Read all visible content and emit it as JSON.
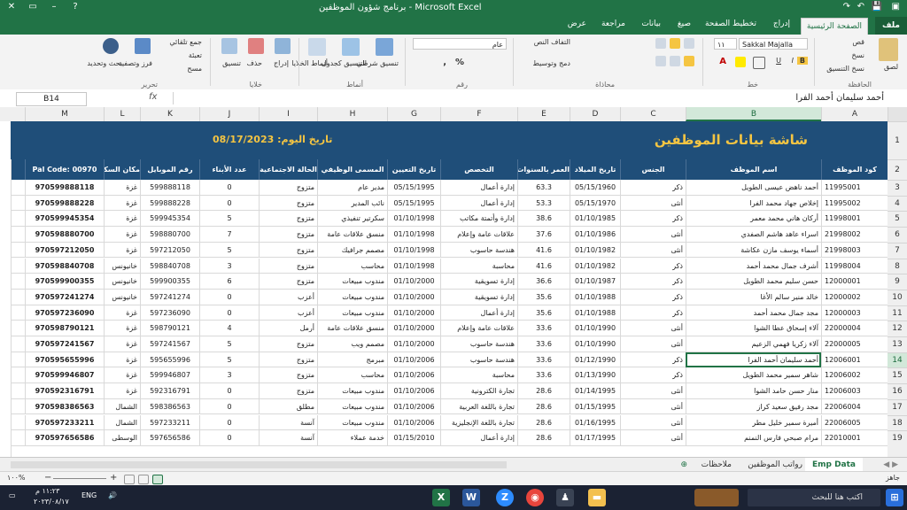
{
  "window": {
    "title": "برنامج شؤون الموظفين  -  Microsoft Excel",
    "min": "–",
    "max": "▭",
    "close": "✕",
    "help": "?"
  },
  "tabs": [
    "ملف",
    "الصفحة الرئيسية",
    "إدراج",
    "تخطيط الصفحة",
    "صيغ",
    "بيانات",
    "مراجعة",
    "عرض"
  ],
  "ribbon": {
    "clipboard": {
      "group": "الحافظة",
      "paste": "لصق",
      "cut": "قص",
      "copy": "نسخ",
      "format_painter": "نسخ التنسيق"
    },
    "font": {
      "group": "خط",
      "name": "Sakkal Majalla",
      "size": "١١",
      "bold": "B",
      "italic": "I",
      "underline": "U"
    },
    "alignment": {
      "group": "محاذاة",
      "wrap": "التفاف النص",
      "merge": "دمج وتوسيط"
    },
    "number": {
      "group": "رقم",
      "format": "عام",
      "percent": "%",
      "comma": ","
    },
    "styles": {
      "group": "أنماط",
      "conditional": "تنسيق شرطي",
      "as_table": "التنسيق كجدول",
      "cell_styles": "أنماط الخلايا"
    },
    "cells": {
      "group": "خلايا",
      "insert": "إدراج",
      "delete": "حذف",
      "format": "تنسيق"
    },
    "editing": {
      "group": "تحرير",
      "autosum": "جمع تلقائي",
      "fill": "تعبئة",
      "clear": "مسح",
      "sort": "فرز وتصفية",
      "find": "بحث وتحديد"
    }
  },
  "formula_bar": {
    "name_box": "B14",
    "fx": "fx",
    "value": "أحمد سليمان أحمد الفرا"
  },
  "columns": [
    "A",
    "B",
    "C",
    "D",
    "E",
    "F",
    "G",
    "H",
    "I",
    "J",
    "K",
    "L",
    "M"
  ],
  "banner": {
    "title": "شاشة بيانات الموظفين",
    "date_label": "تاريخ اليوم:",
    "date_value": "08/17/2023"
  },
  "headers": [
    "كود الموظف",
    "اسم الموظف",
    "الجنس",
    "تاريخ الميلاد",
    "العمر بالسنوات",
    "التخصص",
    "تاريخ التعيين",
    "المسمى الوظيفي",
    "الحالة الاجتماعية",
    "عدد الأبناء",
    "رقم الموبايل",
    "مكان السكن",
    "Pal Code: 00970"
  ],
  "rows": [
    [
      "11995001",
      "أحمد ناهض عيسى الطويل",
      "ذكر",
      "05/15/1960",
      "63.3",
      "إدارة أعمال",
      "05/15/1995",
      "مدير عام",
      "متزوج",
      "0",
      "599888118",
      "غزة",
      "970599888118"
    ],
    [
      "11995002",
      "إخلاص جهاد محمد الفرا",
      "أنثى",
      "05/15/1970",
      "53.3",
      "إدارة أعمال",
      "05/15/1995",
      "نائب المدير",
      "متزوج",
      "0",
      "599888228",
      "غزة",
      "970599888228"
    ],
    [
      "11998001",
      "أركان هاني محمد معمر",
      "ذكر",
      "01/10/1985",
      "38.6",
      "إدارة وأتمتة مكاتب",
      "01/10/1998",
      "سكرتير تنفيذي",
      "متزوج",
      "5",
      "599945354",
      "غزة",
      "970599945354"
    ],
    [
      "21998002",
      "اسراء عاهد هاشم الصفدي",
      "أنثى",
      "01/10/1986",
      "37.6",
      "علاقات عامة وإعلام",
      "01/10/1998",
      "منسق علاقات عامة",
      "متزوج",
      "7",
      "598880700",
      "غزة",
      "970598880700"
    ],
    [
      "21998003",
      "أسماء يوسف مازن عكاشة",
      "أنثى",
      "01/10/1982",
      "41.6",
      "هندسة حاسوب",
      "01/10/1998",
      "مصمم جرافيك",
      "متزوج",
      "5",
      "597212050",
      "غزة",
      "970597212050"
    ],
    [
      "11998004",
      "أشرف جمال محمد أحمد",
      "ذكر",
      "01/10/1982",
      "41.6",
      "محاسبة",
      "01/10/1998",
      "محاسب",
      "متزوج",
      "3",
      "598840708",
      "خانيونس",
      "970598840708"
    ],
    [
      "12000001",
      "حسن سليم محمد الطويل",
      "ذكر",
      "01/10/1987",
      "36.6",
      "إدارة تسويقية",
      "01/10/2000",
      "مندوب مبيعات",
      "متزوج",
      "6",
      "599900355",
      "خانيونس",
      "970599900355"
    ],
    [
      "12000002",
      "خالد منير سالم الأغا",
      "ذكر",
      "01/10/1988",
      "35.6",
      "إدارة تسويقية",
      "01/10/2000",
      "مندوب مبيعات",
      "أعزب",
      "0",
      "597241274",
      "خانيونس",
      "970597241274"
    ],
    [
      "12000003",
      "مجد جمال محمد أحمد",
      "ذكر",
      "01/10/1988",
      "35.6",
      "إدارة أعمال",
      "01/10/2000",
      "مندوب مبيعات",
      "أعزب",
      "0",
      "597236090",
      "غزة",
      "970597236090"
    ],
    [
      "22000004",
      "آلاء إسحاق عطا الشوا",
      "أنثى",
      "01/10/1990",
      "33.6",
      "علاقات عامة وإعلام",
      "01/10/2000",
      "منسق علاقات عامة",
      "أرمل",
      "4",
      "598790121",
      "غزة",
      "970598790121"
    ],
    [
      "22000005",
      "آلاء زكريا فهمي الزعيم",
      "أنثى",
      "01/10/1990",
      "33.6",
      "هندسة حاسوب",
      "01/10/2000",
      "مصمم ويب",
      "متزوج",
      "5",
      "597241567",
      "غزة",
      "970597241567"
    ],
    [
      "12006001",
      "أحمد سليمان أحمد الفرا",
      "ذكر",
      "01/12/1990",
      "33.6",
      "هندسة حاسوب",
      "01/10/2006",
      "مبرمج",
      "متزوج",
      "5",
      "595655996",
      "غزة",
      "970595655996"
    ],
    [
      "12006002",
      "شاهر سمير محمد الطويل",
      "ذكر",
      "01/13/1990",
      "33.6",
      "محاسبة",
      "01/10/2006",
      "محاسب",
      "متزوج",
      "3",
      "599946807",
      "غزة",
      "970599946807"
    ],
    [
      "12006003",
      "منار حسن حامد الشوا",
      "أنثى",
      "01/14/1995",
      "28.6",
      "تجارة الكترونية",
      "01/10/2006",
      "مندوب مبيعات",
      "متزوج",
      "0",
      "592316791",
      "غزة",
      "970592316791"
    ],
    [
      "22006004",
      "مجد رفيق سعيد كراز",
      "أنثى",
      "01/15/1995",
      "28.6",
      "تجارة باللغة العربية",
      "01/10/2006",
      "مندوب مبيعات",
      "مطلق",
      "0",
      "598386563",
      "الشمال",
      "970598386563"
    ],
    [
      "22006005",
      "أميرة سمير خليل مطر",
      "أنثى",
      "01/16/1995",
      "28.6",
      "تجارة باللغة الإنجليزية",
      "01/10/2006",
      "مندوب مبيعات",
      "آنسة",
      "0",
      "597233211",
      "الشمال",
      "970597233211"
    ],
    [
      "22010001",
      "مرام صبحي فارس النمنم",
      "أنثى",
      "01/17/1995",
      "28.6",
      "إدارة أعمال",
      "01/15/2010",
      "خدمة عملاء",
      "آنسة",
      "0",
      "597656586",
      "الوسطى",
      "970597656586"
    ]
  ],
  "row_numbers": [
    "1",
    "2",
    "3",
    "4",
    "5",
    "6",
    "7",
    "8",
    "9",
    "10",
    "11",
    "12",
    "13",
    "14",
    "15",
    "16",
    "17",
    "18",
    "19"
  ],
  "sheet_tabs": {
    "active": "Emp Data",
    "others": [
      "رواتب الموظفين",
      "ملاحظات"
    ],
    "add": "⊕"
  },
  "status": {
    "ready": "جاهز",
    "zoom": "١٠٠%",
    "minus": "−",
    "plus": "+"
  },
  "taskbar": {
    "search": "اكتب هنا للبحث",
    "time": "١١:٢٣ م",
    "date": "٢٠٢٣/٠٨/١٧",
    "lang": "ENG"
  }
}
